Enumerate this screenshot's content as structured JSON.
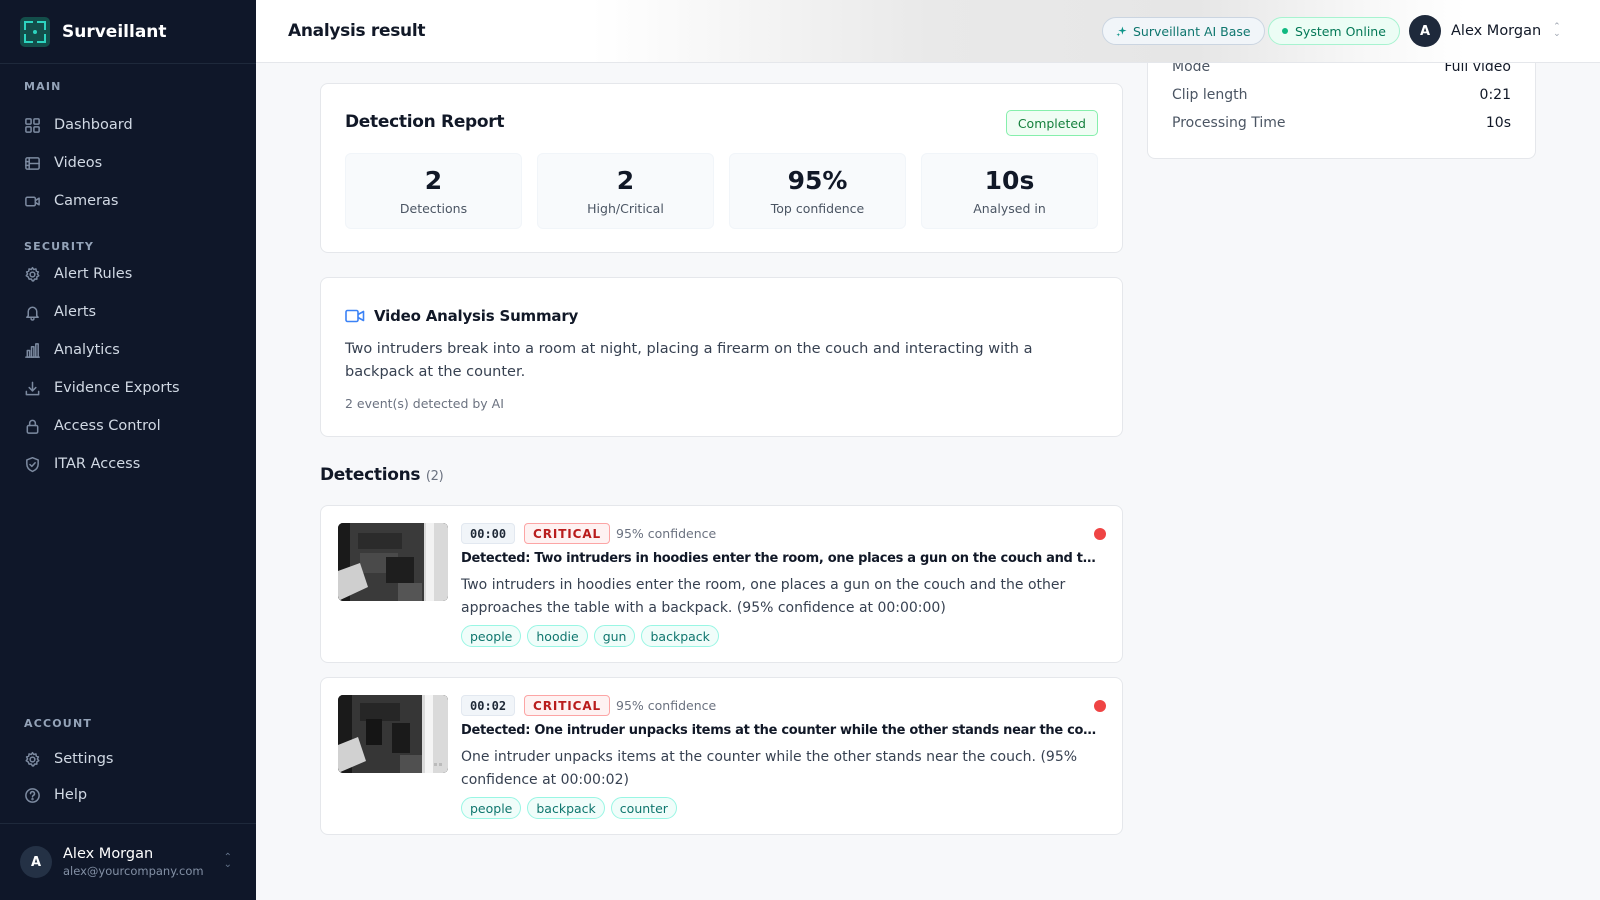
{
  "brand": {
    "name": "Surveillant"
  },
  "sidebar": {
    "sections": [
      {
        "title": "MAIN",
        "items": [
          {
            "label": "Dashboard",
            "icon": "dashboard-icon"
          },
          {
            "label": "Videos",
            "icon": "film-icon"
          },
          {
            "label": "Cameras",
            "icon": "camera-icon"
          }
        ]
      },
      {
        "title": "SECURITY",
        "items": [
          {
            "label": "Alert Rules",
            "icon": "gear-icon"
          },
          {
            "label": "Alerts",
            "icon": "bell-icon"
          },
          {
            "label": "Analytics",
            "icon": "bar-chart-icon"
          },
          {
            "label": "Evidence Exports",
            "icon": "download-icon"
          },
          {
            "label": "Access Control",
            "icon": "lock-icon"
          },
          {
            "label": "ITAR Access",
            "icon": "shield-check-icon"
          }
        ]
      },
      {
        "title": "ACCOUNT",
        "items": [
          {
            "label": "Settings",
            "icon": "gear-icon"
          },
          {
            "label": "Help",
            "icon": "help-circle-icon"
          }
        ]
      }
    ],
    "user": {
      "initial": "A",
      "name": "Alex Morgan",
      "email": "alex@yourcompany.com"
    }
  },
  "header": {
    "title": "Analysis result",
    "ai_badge": "Surveillant AI Base",
    "status_badge": "System Online",
    "user": {
      "initial": "A",
      "name": "Alex Morgan"
    }
  },
  "clip_info": [
    {
      "key": "Mode",
      "value": "Full video"
    },
    {
      "key": "Clip length",
      "value": "0:21"
    },
    {
      "key": "Processing Time",
      "value": "10s"
    }
  ],
  "report": {
    "title": "Detection Report",
    "status": "Completed",
    "stats": [
      {
        "value": "2",
        "label": "Detections"
      },
      {
        "value": "2",
        "label": "High/Critical"
      },
      {
        "value": "95%",
        "label": "Top confidence"
      },
      {
        "value": "10s",
        "label": "Analysed in"
      }
    ]
  },
  "summary": {
    "title": "Video Analysis Summary",
    "text": "Two intruders break into a room at night, placing a firearm on the couch and interacting with a backpack at the counter.",
    "meta": "2 event(s) detected by AI"
  },
  "detections": {
    "title": "Detections",
    "count": "(2)",
    "items": [
      {
        "time": "00:00",
        "severity": "CRITICAL",
        "confidence": "95% confidence",
        "headline": "Detected: Two intruders in hoodies enter the room, one places a gun on the couch and the other approaches the table with a backpack.",
        "description": "Two intruders in hoodies enter the room, one places a gun on the couch and the other approaches the table with a backpack. (95% confidence at 00:00:00)",
        "tags": [
          "people",
          "hoodie",
          "gun",
          "backpack"
        ]
      },
      {
        "time": "00:02",
        "severity": "CRITICAL",
        "confidence": "95% confidence",
        "headline": "Detected: One intruder unpacks items at the counter while the other stands near the couch.",
        "description": "One intruder unpacks items at the counter while the other stands near the couch. (95% confidence at 00:00:02)",
        "tags": [
          "people",
          "backpack",
          "counter"
        ]
      }
    ]
  },
  "colors": {
    "sidebar_bg": "#0f1729",
    "accent": "#0f766e",
    "critical": "#b91c1c",
    "online": "#10b981"
  }
}
